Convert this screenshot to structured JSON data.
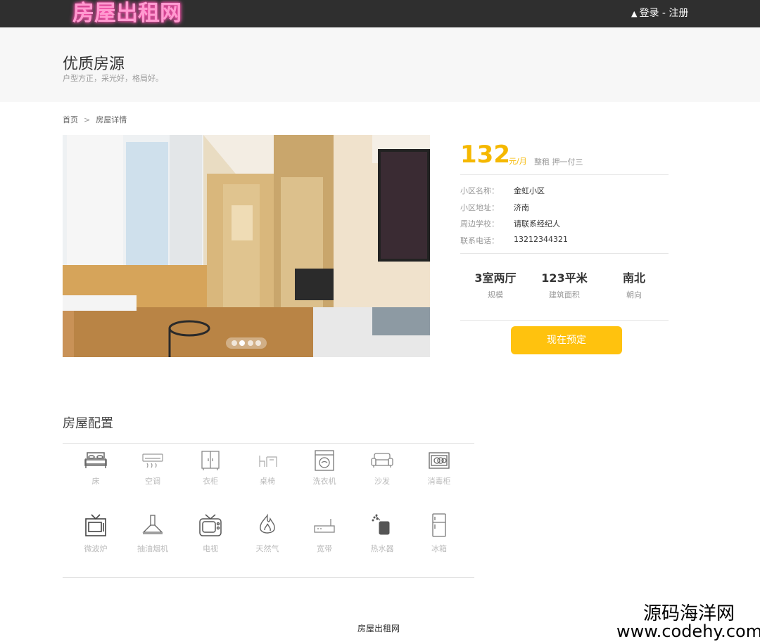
{
  "header": {
    "logo_text": "房屋出租网",
    "login": "登录",
    "separator": " - ",
    "register": "注册"
  },
  "banner": {
    "title": "优质房源",
    "subtitle": "户型方正，采光好，格局好。"
  },
  "breadcrumb": {
    "home": "首页",
    "separator": ">",
    "current": "房屋详情"
  },
  "carousel": {
    "slide_count": 4,
    "active_index": 1
  },
  "listing": {
    "price": "132",
    "price_unit": "元/月",
    "rent_type": "整租 押一付三",
    "details": [
      {
        "label": "小区名称：",
        "value": "金虹小区"
      },
      {
        "label": "小区地址：",
        "value": "济南"
      },
      {
        "label": "周边学校：",
        "value": "请联系经纪人"
      },
      {
        "label": "联系电话：",
        "value": "13212344321"
      }
    ],
    "specs": [
      {
        "value": "3室两厅",
        "label": "规模"
      },
      {
        "value": "123平米",
        "label": "建筑面积"
      },
      {
        "value": "南北",
        "label": "朝向"
      }
    ],
    "book_button": "现在预定"
  },
  "facilities": {
    "title": "房屋配置",
    "items": [
      {
        "label": "床",
        "icon": "bed-icon"
      },
      {
        "label": "空调",
        "icon": "air-conditioner-icon"
      },
      {
        "label": "衣柜",
        "icon": "wardrobe-icon"
      },
      {
        "label": "桌椅",
        "icon": "desk-chair-icon"
      },
      {
        "label": "洗衣机",
        "icon": "washing-machine-icon"
      },
      {
        "label": "沙发",
        "icon": "sofa-icon"
      },
      {
        "label": "消毒柜",
        "icon": "sterilizer-icon"
      },
      {
        "label": "微波炉",
        "icon": "microwave-icon"
      },
      {
        "label": "抽油烟机",
        "icon": "range-hood-icon"
      },
      {
        "label": "电视",
        "icon": "tv-icon"
      },
      {
        "label": "天然气",
        "icon": "flame-icon"
      },
      {
        "label": "宽带",
        "icon": "router-icon"
      },
      {
        "label": "热水器",
        "icon": "water-heater-icon"
      },
      {
        "label": "冰箱",
        "icon": "fridge-icon"
      }
    ]
  },
  "footer": {
    "text": "房屋出租网"
  },
  "watermark": {
    "line1": "源码海洋网",
    "line2": "www.codehy.com"
  },
  "colors": {
    "topbar": "#2f2f2f",
    "accent": "#ffc20e",
    "price": "#f5b800",
    "banner_bg": "#f7f7f7"
  }
}
